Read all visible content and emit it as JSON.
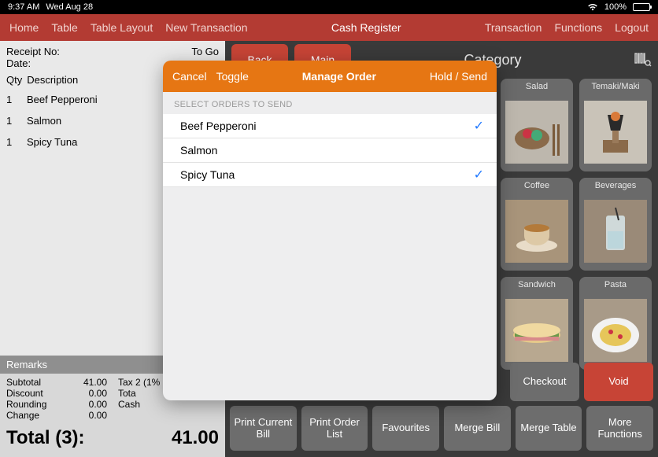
{
  "status": {
    "time": "9:37 AM",
    "date": "Wed Aug 28",
    "battery_pct": "100%"
  },
  "topnav": {
    "left": [
      "Home",
      "Table",
      "Table Layout",
      "New Transaction"
    ],
    "center": "Cash Register",
    "right": [
      "Transaction",
      "Functions",
      "Logout"
    ]
  },
  "receipt": {
    "receipt_no_label": "Receipt No:",
    "togo": "To Go",
    "date_label": "Date:",
    "col_qty": "Qty",
    "col_desc": "Description",
    "items": [
      {
        "qty": "1",
        "name": "Beef Pepperoni"
      },
      {
        "qty": "1",
        "name": "Salmon"
      },
      {
        "qty": "1",
        "name": "Spicy Tuna"
      }
    ],
    "remarks_label": "Remarks",
    "totals": {
      "subtotal_label": "Subtotal",
      "subtotal": "41.00",
      "tax_label": "Tax 2 (1%",
      "discount_label": "Discount",
      "discount": "0.00",
      "tota_label": "Tota",
      "rounding_label": "Rounding",
      "rounding": "0.00",
      "cash_label": "Cash",
      "change_label": "Change",
      "change": "0.00"
    },
    "grand_label": "Total (3):",
    "grand_value": "41.00"
  },
  "rhs": {
    "back": "Back",
    "main": "Main",
    "category_title": "Category",
    "categories": [
      "Salad",
      "Temaki/Maki",
      "Coffee",
      "Beverages",
      "Sandwich",
      "Pasta"
    ]
  },
  "bottom": {
    "checkout": "Checkout",
    "void": "Void",
    "print_current": "Print Current Bill",
    "print_order": "Print Order List",
    "favourites": "Favourites",
    "merge_bill": "Merge Bill",
    "merge_table": "Merge Table",
    "more": "More Functions"
  },
  "modal": {
    "cancel": "Cancel",
    "toggle": "Toggle",
    "title": "Manage Order",
    "hold_send": "Hold / Send",
    "section": "SELECT ORDERS TO SEND",
    "items": [
      {
        "name": "Beef Pepperoni",
        "checked": true
      },
      {
        "name": "Salmon",
        "checked": false
      },
      {
        "name": "Spicy Tuna",
        "checked": true
      }
    ]
  }
}
